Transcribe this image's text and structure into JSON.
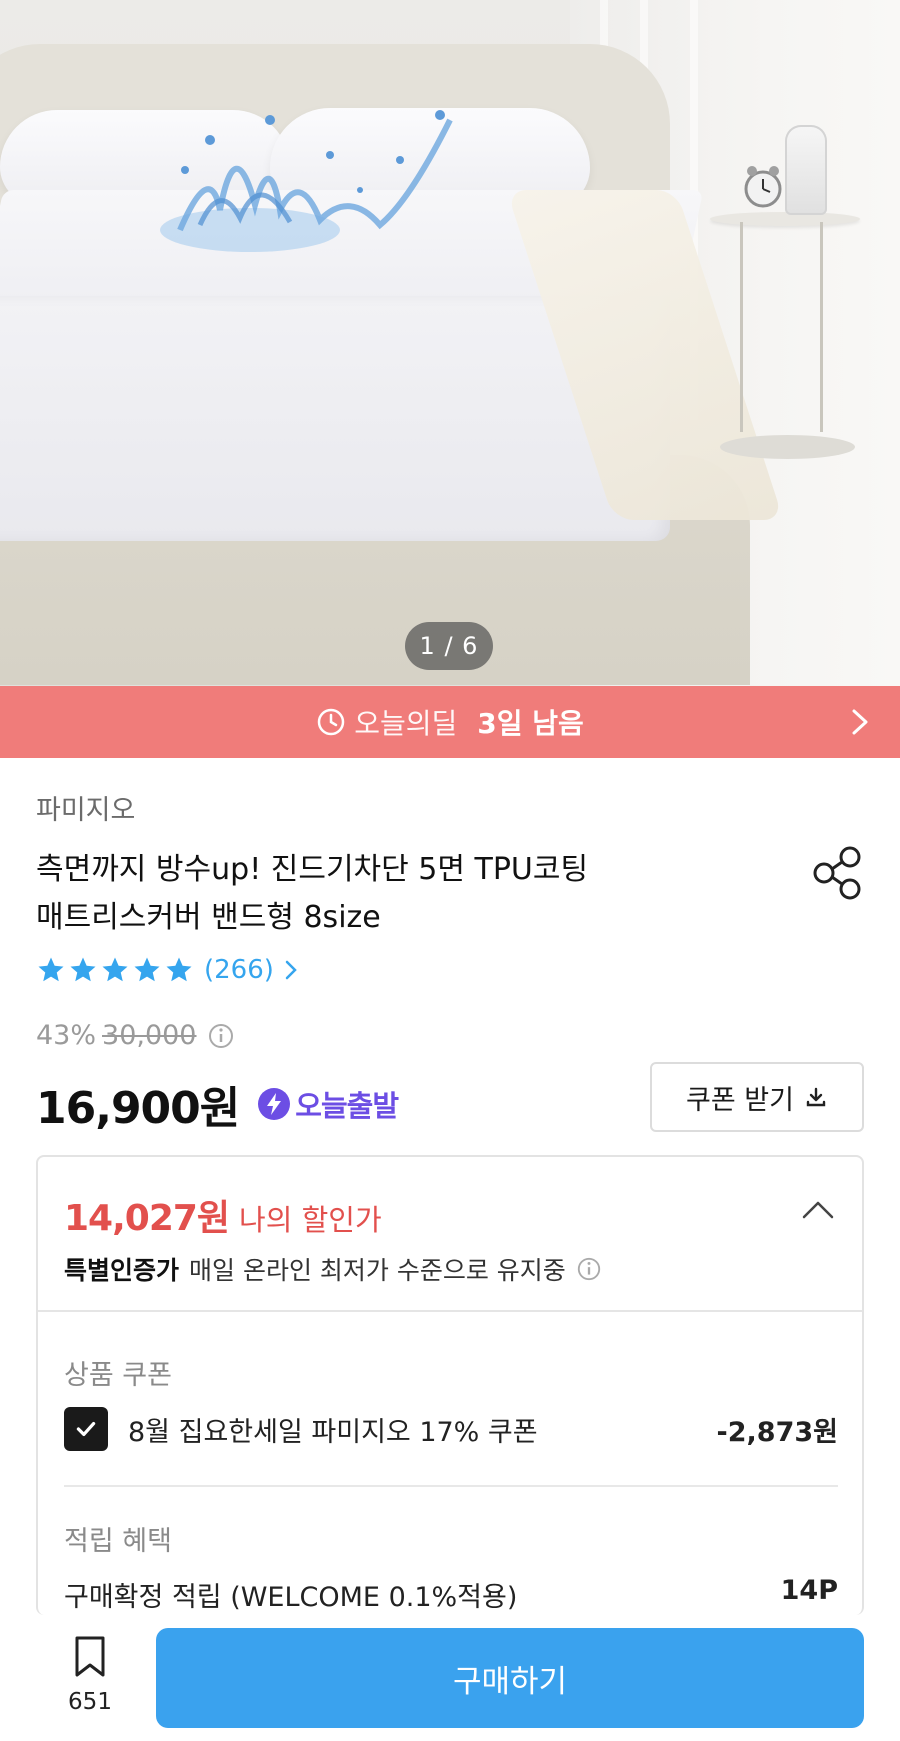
{
  "gallery": {
    "counter": "1 / 6"
  },
  "deal": {
    "label": "오늘의딜",
    "remaining": "3일 남음",
    "icon": "clock-icon",
    "color": "#f07c7a"
  },
  "product": {
    "brand": "파미지오",
    "title_line1": "측면까지 방수up! 진드기차단 5면 TPU코팅",
    "title_line2": "매트리스커버 밴드형 8size",
    "rating": {
      "stars": 5,
      "review_count": "(266)"
    },
    "discount_percent": "43%",
    "original_price": "30,000",
    "price": "16,900원",
    "shipping_badge": "오늘출발",
    "coupon_button": "쿠폰 받기"
  },
  "discount_box": {
    "my_price": "14,027원",
    "my_price_label": "나의 할인가",
    "special_bold": "특별인증가",
    "special_desc": "매일 온라인 최저가 수준으로 유지중",
    "coupon_section_label": "상품 쿠폰",
    "coupon_name": "8월 집요한세일 파미지오 17% 쿠폰",
    "coupon_value": "-2,873원",
    "coupon_checked": true,
    "points_section_label": "적립 혜택",
    "points_name": "구매확정 적립 (WELCOME 0.1%적용)",
    "points_value": "14P"
  },
  "bottom_bar": {
    "bookmark_count": "651",
    "buy_label": "구매하기",
    "buy_color": "#3aa2ee"
  },
  "colors": {
    "accent_blue": "#35a5ee",
    "discount_red": "#e2504d",
    "shipping_purple": "#6c4ee4"
  }
}
